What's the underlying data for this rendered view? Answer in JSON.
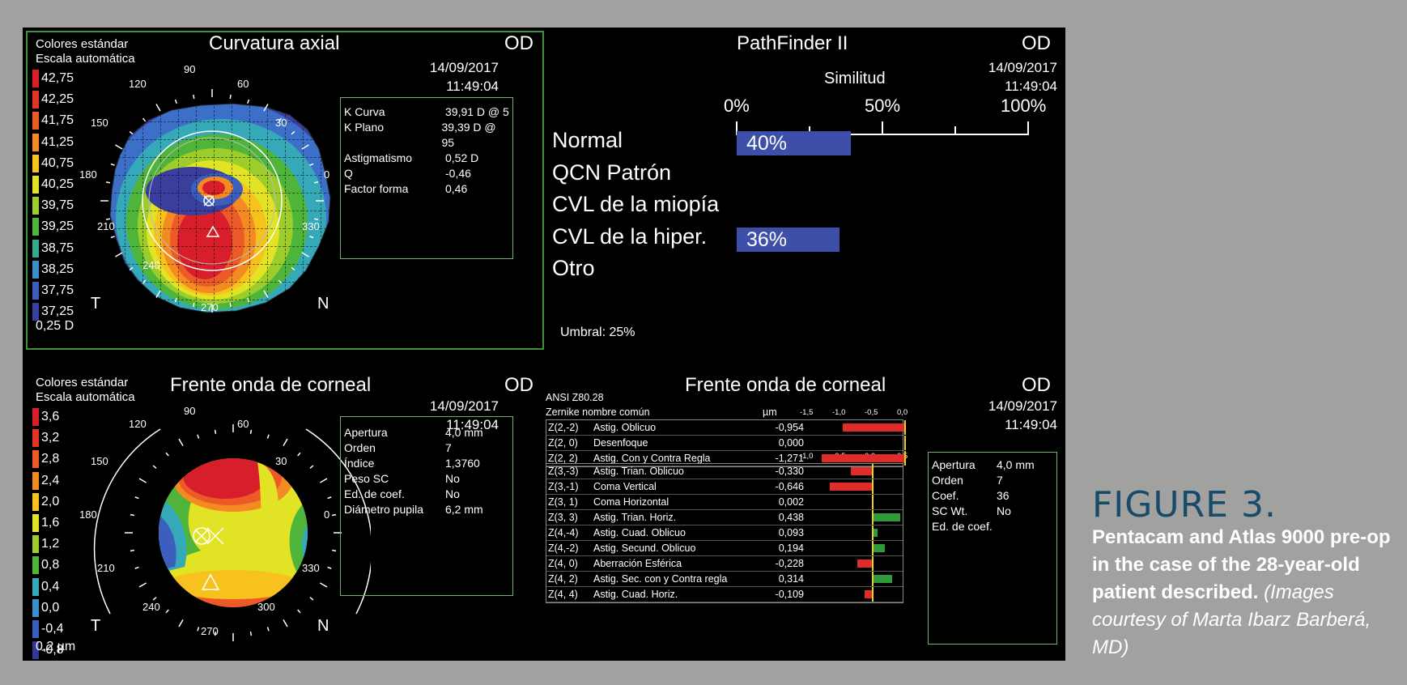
{
  "axial": {
    "header1": "Colores estándar",
    "header2": "Escala automática",
    "title": "Curvatura axial",
    "eye": "OD",
    "date": "14/09/2017",
    "time": "11:49:04",
    "scale": [
      "42,75",
      "42,25",
      "41,75",
      "41,25",
      "40,75",
      "40,25",
      "39,75",
      "39,25",
      "38,75",
      "38,25",
      "37,75",
      "37,25"
    ],
    "step": "0,25 D",
    "degrees": {
      "d90": "90",
      "d120": "120",
      "d60": "60",
      "d150": "150",
      "d30": "30",
      "d180": "180",
      "d0": "0",
      "d210": "210",
      "d330": "330",
      "d240": "240",
      "d270": "270"
    },
    "t": "T",
    "n": "N",
    "info": [
      {
        "k": "K Curva",
        "v": "39,91 D @ 5"
      },
      {
        "k": "K Plano",
        "v": "39,39 D @ 95"
      },
      {
        "k": "Astigmatismo",
        "v": "0,52 D"
      },
      {
        "k": "Q",
        "v": "-0,46"
      },
      {
        "k": "Factor forma",
        "v": "0,46"
      }
    ]
  },
  "pathfinder": {
    "title": "PathFinder II",
    "eye": "OD",
    "date": "14/09/2017",
    "time": "11:49:04",
    "sim": "Similitud",
    "p0": "0%",
    "p50": "50%",
    "p100": "100%",
    "rows": [
      {
        "label": "Normal",
        "value": "40%",
        "frac": 0.4
      },
      {
        "label": "QCN Patrón",
        "value": "",
        "frac": 0
      },
      {
        "label": "CVL de la miopía",
        "value": "",
        "frac": 0
      },
      {
        "label": "CVL de la hiper.",
        "value": "36%",
        "frac": 0.36
      },
      {
        "label": "Otro",
        "value": "",
        "frac": 0
      }
    ],
    "umbral": "Umbral: 25%"
  },
  "wavefront": {
    "header1": "Colores estándar",
    "header2": "Escala automática",
    "title": "Frente onda de corneal",
    "eye": "OD",
    "date": "14/09/2017",
    "time": "11:49:04",
    "scale": [
      "3,6",
      "3,2",
      "2,8",
      "2,4",
      "2,0",
      "1,6",
      "1,2",
      "0,8",
      "0,4",
      "0,0",
      "-0,4",
      "-0,8"
    ],
    "step": "0,2 µm",
    "degrees": {
      "d90": "90",
      "d120": "120",
      "d60": "60",
      "d150": "150",
      "d30": "30",
      "d180": "180",
      "d0": "0",
      "d210": "210",
      "d330": "330",
      "d240": "240",
      "d270": "270",
      "d300": "300"
    },
    "t": "T",
    "n": "N",
    "info": [
      {
        "k": "Apertura",
        "v": "4,0 mm"
      },
      {
        "k": "Orden",
        "v": "7"
      },
      {
        "k": "Índice",
        "v": "1,3760"
      },
      {
        "k": "Peso SC",
        "v": "No"
      },
      {
        "k": "Ed. de coef.",
        "v": "No"
      },
      {
        "k": "Diámetro pupila",
        "v": "6,2 mm"
      }
    ]
  },
  "zernike": {
    "title": "Frente onda de corneal",
    "eye": "OD",
    "date": "14/09/2017",
    "time": "11:49:04",
    "std": "ANSI Z80.28",
    "h_name": "Zernike nombre común",
    "h_unit": "µm",
    "axis1": [
      "-1,5",
      "-1,0",
      "-0,5",
      "0,0"
    ],
    "axis2": [
      "-1,0",
      "-0,5",
      "0,0",
      "0,5"
    ],
    "group1": [
      {
        "z": "Z(2,-2)",
        "name": "Astig. Oblicuo",
        "v": "-0,954",
        "n": -0.954
      },
      {
        "z": "Z(2, 0)",
        "name": "Desenfoque",
        "v": "0,000",
        "n": 0
      },
      {
        "z": "Z(2, 2)",
        "name": "Astig. Con y Contra Regla",
        "v": "-1,271",
        "n": -1.271
      }
    ],
    "group2": [
      {
        "z": "Z(3,-3)",
        "name": "Astig. Trian. Oblicuo",
        "v": "-0,330",
        "n": -0.33
      },
      {
        "z": "Z(3,-1)",
        "name": "Coma Vertical",
        "v": "-0,646",
        "n": -0.646
      },
      {
        "z": "Z(3, 1)",
        "name": "Coma Horizontal",
        "v": "0,002",
        "n": 0.002
      },
      {
        "z": "Z(3, 3)",
        "name": "Astig. Trian. Horiz.",
        "v": "0,438",
        "n": 0.438
      },
      {
        "z": "Z(4,-4)",
        "name": "Astig. Cuad. Oblicuo",
        "v": "0,093",
        "n": 0.093
      },
      {
        "z": "Z(4,-2)",
        "name": "Astig. Secund. Oblicuo",
        "v": "0,194",
        "n": 0.194
      },
      {
        "z": "Z(4, 0)",
        "name": "Aberración Esférica",
        "v": "-0,228",
        "n": -0.228
      },
      {
        "z": "Z(4, 2)",
        "name": "Astig. Sec. con y Contra regla",
        "v": "0,314",
        "n": 0.314
      },
      {
        "z": "Z(4, 4)",
        "name": "Astig. Cuad. Horiz.",
        "v": "-0,109",
        "n": -0.109
      }
    ],
    "info": [
      {
        "k": "Apertura",
        "v": "4,0 mm"
      },
      {
        "k": "Orden",
        "v": "7"
      },
      {
        "k": "Coef.",
        "v": "36"
      },
      {
        "k": "SC Wt.",
        "v": "No"
      },
      {
        "k": "Ed. de coef.",
        "v": ""
      }
    ]
  },
  "figure": {
    "label": "FIGURE 3.",
    "caption": "Pentacam and Atlas 9000 pre-op in the case of the 28-year-old patient described.",
    "credit": "(Images courtesy of Marta Ibarz Barberá, MD)"
  },
  "colors": {
    "scale_axial": [
      "#d81e2a",
      "#e2342a",
      "#ec5a28",
      "#f38a22",
      "#f7c21e",
      "#e2e324",
      "#9ccd2a",
      "#4eb43a",
      "#36a98e",
      "#3a8fcb",
      "#3c5fbe",
      "#3a3f9e"
    ],
    "scale_wave": [
      "#d81e2a",
      "#e2342a",
      "#ec5a28",
      "#f38a22",
      "#f7c21e",
      "#e2e324",
      "#9ccd2a",
      "#4eb43a",
      "#36a9b8",
      "#3a8fcb",
      "#3c5fbe",
      "#333a96"
    ],
    "neg_bar": "#e02b2b",
    "pos_bar": "#2e9a3a",
    "pf_bar": "#3d4fa8",
    "panel_border": "#3f8f3f"
  }
}
